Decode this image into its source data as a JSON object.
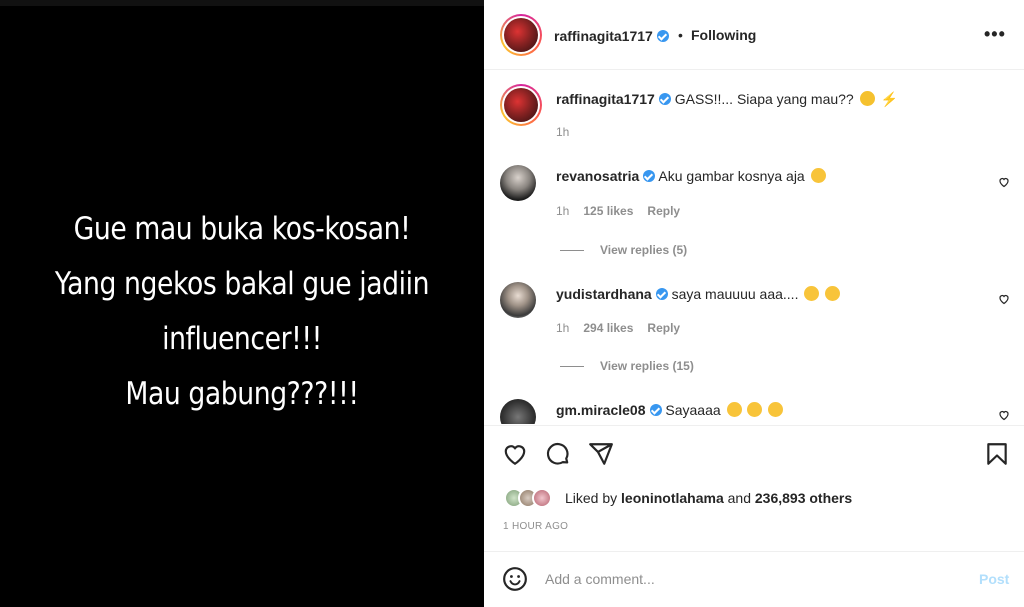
{
  "media": {
    "lines": [
      "Gue mau buka kos-kosan!",
      "Yang ngekos bakal gue jadiin",
      "influencer!!!",
      "Mau gabung???!!!"
    ]
  },
  "header": {
    "username": "raffinagita1717",
    "separator": "•",
    "follow_status": "Following",
    "more_label": "•••"
  },
  "caption": {
    "username": "raffinagita1717",
    "text": "GASS!!... Siapa yang mau??",
    "time": "1h"
  },
  "comments": [
    {
      "username": "revanosatria",
      "text": "Aku gambar kosnya aja",
      "time": "1h",
      "likes": "125 likes",
      "reply": "Reply",
      "view_replies": "View replies (5)"
    },
    {
      "username": "yudistardhana",
      "text": "saya mauuuu aaa....",
      "time": "1h",
      "likes": "294 likes",
      "reply": "Reply",
      "view_replies": "View replies (15)"
    },
    {
      "username": "gm.miracle08",
      "text": "Sayaaaa"
    }
  ],
  "actions": {
    "icons": [
      "heart-icon",
      "comment-icon",
      "share-icon",
      "bookmark-icon"
    ]
  },
  "likes": {
    "prefix": "Liked by",
    "user": "leoninotlahama",
    "and": "and",
    "count": "236,893 others"
  },
  "timestamp": "1 HOUR AGO",
  "comment_box": {
    "placeholder": "Add a comment...",
    "post_label": "Post"
  },
  "colors": {
    "verified": "#3897f0",
    "post_button": "#b2dffc",
    "secondary_text": "#8e8e8e"
  }
}
